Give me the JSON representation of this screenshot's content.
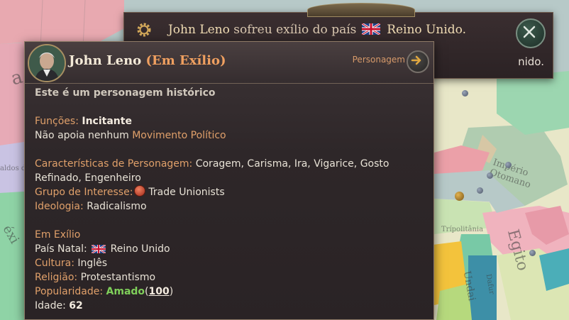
{
  "notification": {
    "name": "John Leno",
    "message_part": "sofreu exílio do país",
    "country": "Reino Unido.",
    "body_visible": "nido.",
    "icons": {
      "settings": "gear-icon",
      "close": "close-icon",
      "flag": "uk-flag-icon"
    }
  },
  "tooltip": {
    "name": "John Leno",
    "status": "(Em Exílio)",
    "portrait": "character-portrait",
    "type_label": "Personagem",
    "go_icon": "arrow-right-icon",
    "subtitle": "Este é um personagem histórico",
    "functions_label": "Funções:",
    "functions_value": "Incitante",
    "movement_prefix": "Não apoia nenhum",
    "movement_link": "Movimento Político",
    "traits_label": "Características de Personagem:",
    "traits_value": "Coragem, Carisma, Ira, Vigarice, Gosto Refinado, Engenheiro",
    "ig_label": "Grupo de Interesse:",
    "ig_value": "Trade Unionists",
    "ideology_label": "Ideologia:",
    "ideology_value": "Radicalismo",
    "exile_header": "Em Exílio",
    "homeland_label": "País Natal:",
    "homeland_value": "Reino Unido",
    "culture_label": "Cultura:",
    "culture_value": "Inglês",
    "religion_label": "Religião:",
    "religion_value": "Protestantismo",
    "popularity_label": "Popularidade:",
    "popularity_word": "Amado",
    "popularity_open": "(",
    "popularity_value": "100",
    "popularity_close": ")",
    "age_label": "Idade:",
    "age_value": "62"
  },
  "map_labels": {
    "left_a": "a",
    "left_b": "aldos do",
    "left_c": "éxi",
    "turkey": "Império Otomano",
    "libya": "Trípolitânia",
    "egypt": "Egito",
    "sudan1": "Dafur",
    "sudan2": "Undai"
  },
  "colors": {
    "accent_orange": "#e0a06a",
    "exile_orange": "#f0a060",
    "positive_green": "#7fcf5a",
    "panel_bg": "#2e2729"
  }
}
